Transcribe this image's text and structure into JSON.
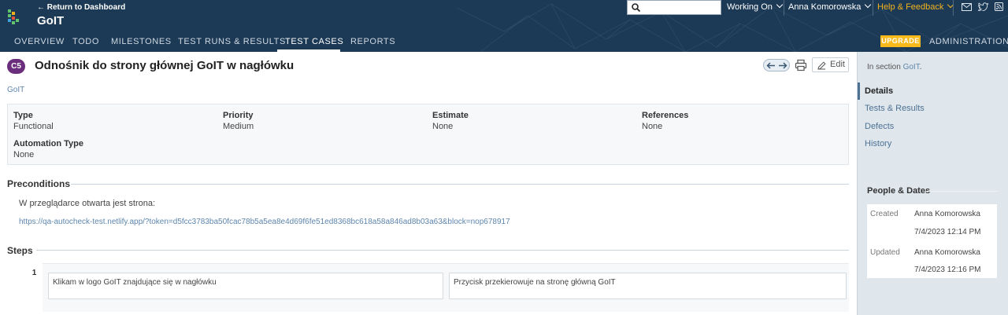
{
  "header": {
    "return_link": "← Return to Dashboard",
    "project_title": "GoIT",
    "search": {
      "value": "",
      "placeholder": ""
    },
    "working_on": "Working On",
    "user": "Anna Komorowska",
    "help": "Help & Feedback",
    "upgrade": "UPGRADE",
    "administration": "ADMINISTRATION",
    "tabs": [
      {
        "label": "OVERVIEW"
      },
      {
        "label": "TODO"
      },
      {
        "label": "MILESTONES"
      },
      {
        "label": "TEST RUNS & RESULTS"
      },
      {
        "label": "TEST CASES",
        "active": true
      },
      {
        "label": "REPORTS"
      }
    ],
    "icons": [
      "search-icon",
      "mail-icon",
      "twitter-icon",
      "rss-icon",
      "logo-icon"
    ]
  },
  "case": {
    "badge": "C5",
    "title": "Odnośnik do strony głównej GoIT w nagłówku",
    "edit_label": "Edit",
    "breadcrumb": "GoIT"
  },
  "fields": {
    "type_label": "Type",
    "type_value": "Functional",
    "priority_label": "Priority",
    "priority_value": "Medium",
    "estimate_label": "Estimate",
    "estimate_value": "None",
    "references_label": "References",
    "references_value": "None",
    "automation_label": "Automation Type",
    "automation_value": "None"
  },
  "preconditions": {
    "heading": "Preconditions",
    "text": "W przeglądarce otwarta jest strona:",
    "link": "https://qa-autocheck-test.netlify.app/?token=d5fcc3783ba50fcac78b5a5ea8e4d69f6fe51ed8368bc618a58a846ad8b03a63&block=nop678917"
  },
  "steps": {
    "heading": "Steps",
    "items": [
      {
        "number": "1",
        "content": "Klikam w logo GoIT znajdujące się w nagłówku",
        "expected": "Przycisk przekierowuje na stronę główną GoIT"
      }
    ]
  },
  "sidebar": {
    "in_section_prefix": "In section",
    "in_section_link": "GoIT",
    "in_section_suffix": ".",
    "links": [
      {
        "label": "Details",
        "active": true
      },
      {
        "label": "Tests & Results"
      },
      {
        "label": "Defects"
      },
      {
        "label": "History"
      }
    ],
    "people_heading": "People & Dates",
    "created_label": "Created",
    "created_by": "Anna Komorowska",
    "created_at": "7/4/2023 12:14 PM",
    "updated_label": "Updated",
    "updated_by": "Anna Komorowska",
    "updated_at": "7/4/2023 12:16 PM"
  },
  "colors": {
    "header_bg": "#1c3a56",
    "accent": "#f8b91c",
    "help": "#f3b21b",
    "badge": "#6b2e7c",
    "link": "#5e86ad",
    "sidebar_bg": "#dfe6ec"
  }
}
